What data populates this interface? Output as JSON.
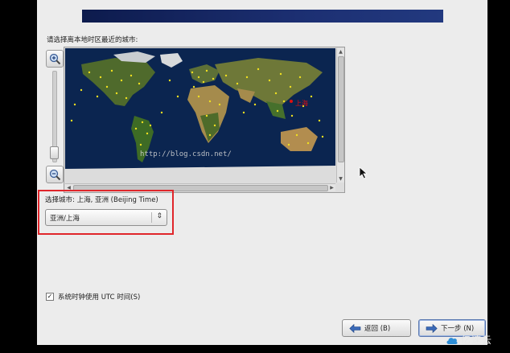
{
  "prompt": "请选择离本地时区最近的城市:",
  "map": {
    "city_label": "上海",
    "watermark": "http://blog.csdn.net/"
  },
  "selection": {
    "label": "选择城市: 上海, 亚洲 (Beijing Time)",
    "value": "亚洲/上海"
  },
  "utc": {
    "checked": true,
    "check_glyph": "☑",
    "label": "系统时钟使用 UTC 时间(S)"
  },
  "buttons": {
    "back": "返回 (B)",
    "next": "下一步 (N)"
  },
  "logo": {
    "text": "亿速云"
  },
  "colors": {
    "highlight": "#e0262b",
    "banner": "#1c2f72",
    "city_marker": "#e01010",
    "city_dots": "#f0e020"
  }
}
